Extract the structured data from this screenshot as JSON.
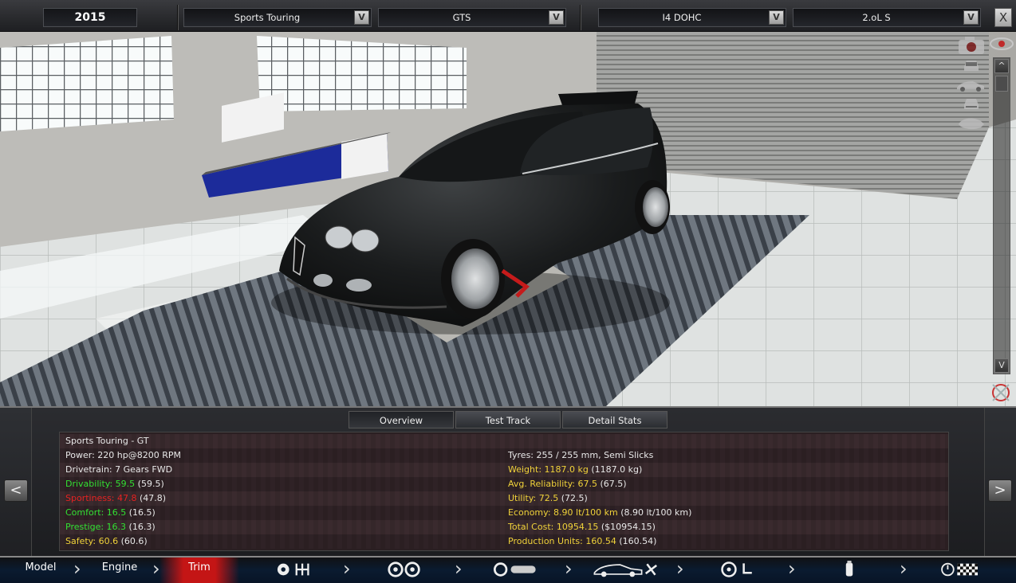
{
  "topbar": {
    "year": "2015",
    "model_family": "Sports Touring",
    "trim": "GTS",
    "engine_layout": "I4 DOHC",
    "engine_size": "2.oL S",
    "dropdown_btn": "V",
    "close": "X"
  },
  "viewport": {
    "scroll_up": "^",
    "scroll_down": "V"
  },
  "panel": {
    "tabs": [
      {
        "label": "Overview"
      },
      {
        "label": "Test Track"
      },
      {
        "label": "Detail Stats"
      }
    ],
    "prev": "<",
    "next": ">",
    "title": "Sports Touring - GT",
    "left": [
      {
        "label": "Power: 220 hp@8200 RPM",
        "extra": ""
      },
      {
        "label": "Drivetrain: 7 Gears FWD",
        "extra": ""
      },
      {
        "label": "Drivability: 59.5",
        "extra": "(59.5)"
      },
      {
        "label": "Sportiness: 47.8",
        "extra": "(47.8)"
      },
      {
        "label": "Comfort: 16.5",
        "extra": "(16.5)"
      },
      {
        "label": "Prestige: 16.3",
        "extra": "(16.3)"
      },
      {
        "label": "Safety: 60.6",
        "extra": "(60.6)"
      }
    ],
    "right": [
      {
        "label": "Tyres: 255 / 255 mm, Semi Slicks",
        "extra": ""
      },
      {
        "label": "Weight: 1187.0 kg",
        "extra": "(1187.0 kg)"
      },
      {
        "label": "Avg. Reliability: 67.5",
        "extra": "(67.5)"
      },
      {
        "label": "Utility: 72.5",
        "extra": "(72.5)"
      },
      {
        "label": "Economy: 8.90 lt/100 km",
        "extra": "(8.90 lt/100 km)"
      },
      {
        "label": "Total Cost: 10954.15",
        "extra": "($10954.15)"
      },
      {
        "label": "Production Units: 160.54",
        "extra": "(160.54)"
      }
    ]
  },
  "nav": {
    "model": "Model",
    "engine": "Engine",
    "trim": "Trim"
  },
  "colors": {
    "good": "#33e033",
    "bad": "#e62222",
    "warn": "#f0d23a",
    "active_nav": "#c41515"
  }
}
